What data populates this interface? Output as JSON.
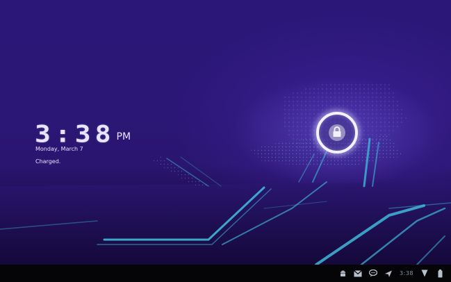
{
  "lockscreen": {
    "clock_time": "3:38",
    "clock_ampm": "PM",
    "date": "Monday, March 7",
    "status": "Charged.",
    "unlock_icon": "lock-icon"
  },
  "system_bar": {
    "icons": [
      "android-icon",
      "gmail-icon",
      "talk-icon",
      "airplane-icon",
      "signal-icon",
      "battery-icon"
    ],
    "time": "3:38"
  },
  "colors": {
    "wallpaper_base": "#2a1777",
    "accent_cyan": "#3fb8d8",
    "taskbar": "#050507",
    "text": "#e8e4ff"
  }
}
